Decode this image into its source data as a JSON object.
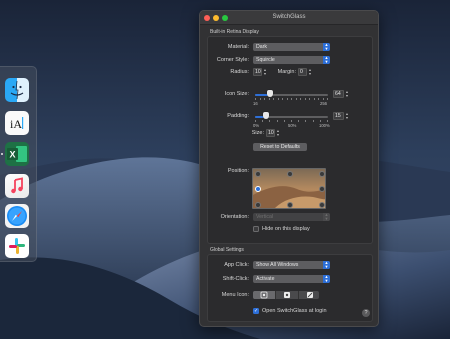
{
  "window": {
    "title": "SwitchGlass"
  },
  "display_section": {
    "title": "Built-in Retina Display",
    "material": {
      "label": "Material:",
      "value": "Dark"
    },
    "corner_style": {
      "label": "Corner Style:",
      "value": "Squircle"
    },
    "radius": {
      "label": "Radius:",
      "value": "10"
    },
    "margin": {
      "label": "Margin:",
      "value": "0"
    },
    "icon_size": {
      "label": "Icon Size:",
      "value": "64",
      "min_label": "16",
      "max_label": "256",
      "level": 0.2
    },
    "padding": {
      "label": "Padding:",
      "value": "15",
      "min_label": "0%",
      "mid_label": "50%",
      "max_label": "100%",
      "level": 0.15
    },
    "size": {
      "label": "Size:",
      "value": "10"
    },
    "reset_button": "Reset to Defaults",
    "position": {
      "label": "Position:"
    },
    "orientation": {
      "label": "Orientation:",
      "value": "Vertical"
    },
    "hide_on_display": {
      "label": "Hide on this display",
      "checked": false
    }
  },
  "global_section": {
    "title": "Global Settings",
    "app_click": {
      "label": "App Click:",
      "value": "Show All Windows"
    },
    "shift_click": {
      "label": "Shift-Click:",
      "value": "Activate"
    },
    "menu_icon": {
      "label": "Menu Icon:"
    },
    "open_at_login": {
      "label": "Open SwitchGlass at login",
      "checked": true
    },
    "help": "?"
  },
  "dock": {
    "apps": [
      "finder-icon",
      "text-editor-icon",
      "excel-icon",
      "music-icon",
      "safari-icon",
      "slack-icon"
    ]
  },
  "colors": {
    "accent": "#2d6fd8",
    "window_bg": "#323234"
  }
}
